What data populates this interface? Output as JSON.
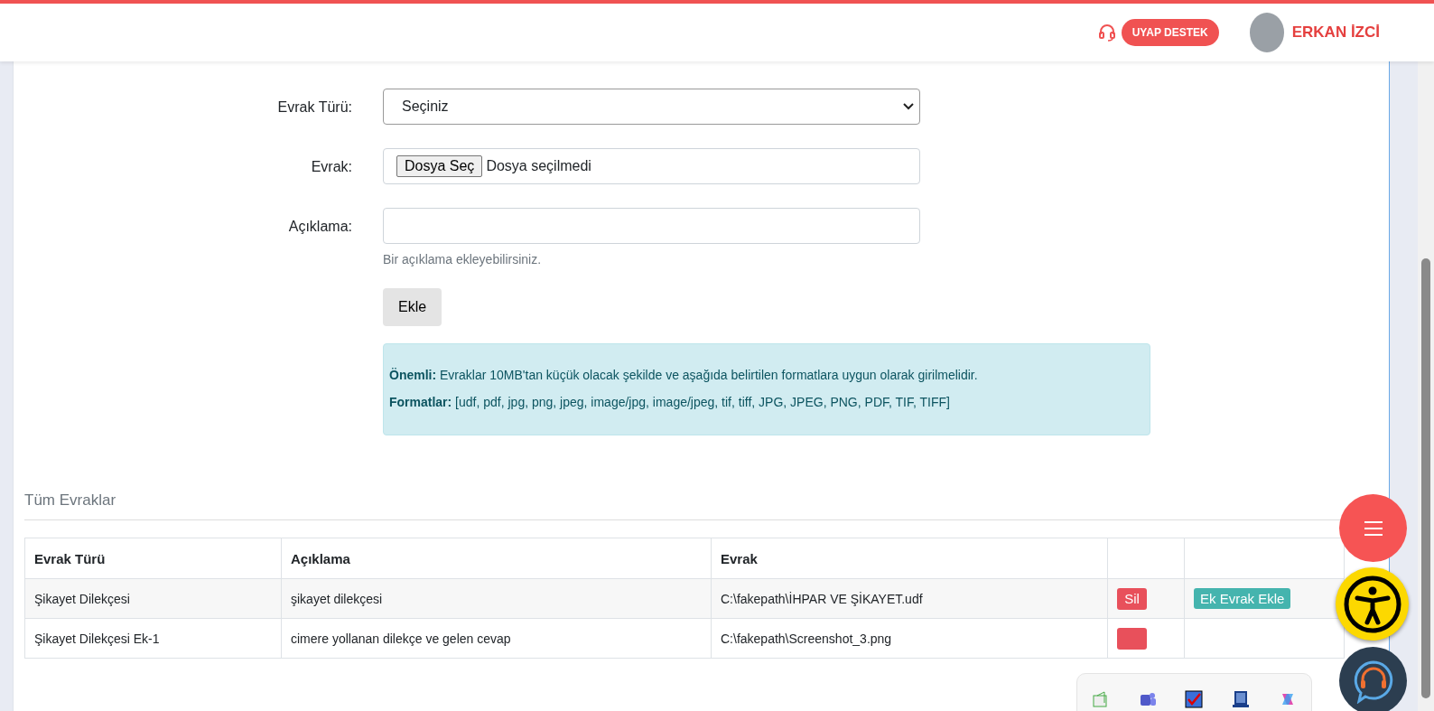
{
  "header": {
    "support_button": "UYAP DESTEK",
    "user_name": "ERKAN İZCİ"
  },
  "form": {
    "fields": [
      {
        "kind": "select",
        "label": "Evrak Türü:",
        "value": "Seçiniz"
      },
      {
        "kind": "file",
        "label": "Evrak:",
        "button": "Dosya Seç",
        "value": "Dosya seçilmedi"
      },
      {
        "kind": "text",
        "label": "Açıklama:",
        "help": "Bir açıklama ekleyebilirsiniz."
      }
    ],
    "submit_button": "Ekle",
    "notice": [
      "**Önemli:** Evraklar 10MB'tan küçük olacak şekilde ve aşağıda belirtilen formatlara uygun olarak girilmelidir.",
      "**Formatlar:** [udf, pdf, jpg, png, jpeg, image/jpg, image/jpeg, tif, tiff, JPG, JPEG, PNG, PDF, TIF, TIFF]"
    ]
  },
  "documents": {
    "title": "Tüm Evraklar",
    "columns": [
      "Evrak Türü",
      "Açıklama",
      "Evrak"
    ],
    "rows": [
      {
        "cells": [
          "Şikayet Dilekçesi",
          "şikayet dilekçesi",
          "C:\\fakepath\\İHPAR VE ŞİKAYET.udf"
        ],
        "actions": [
          {
            "kind": "delete",
            "label": "Sil"
          },
          {
            "kind": "add",
            "label": "Ek Evrak Ekle"
          }
        ]
      },
      {
        "cells": [
          "Şikayet Dilekçesi Ek-1",
          "cimere yollanan dilekçe ve gelen cevap",
          "C:\\fakepath\\Screenshot_3.png"
        ],
        "actions": [
          {
            "kind": "delete"
          }
        ]
      }
    ]
  }
}
